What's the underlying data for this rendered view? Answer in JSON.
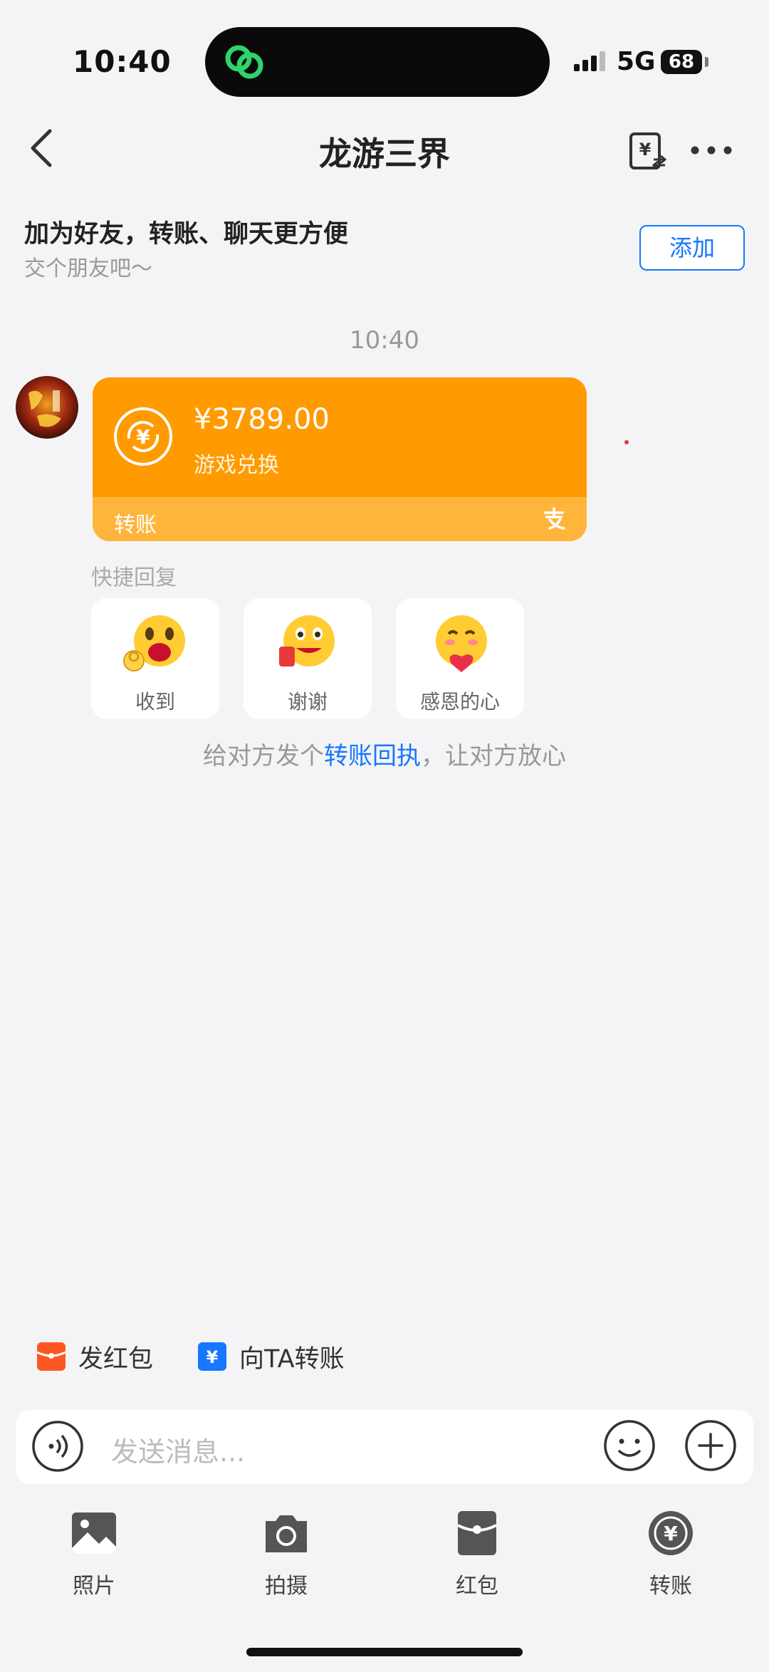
{
  "status_bar": {
    "time": "10:40",
    "network": "5G",
    "battery": "68"
  },
  "header": {
    "title": "龙游三界"
  },
  "promo": {
    "title": "加为好友，转账、聊天更方便",
    "subtitle": "交个朋友吧～",
    "add_label": "添加"
  },
  "chat": {
    "timestamp": "10:40",
    "transfer_card": {
      "amount": "¥3789.00",
      "description": "游戏兑换",
      "footer_label": "转账",
      "accent": "#ff9a00"
    },
    "quick_reply": {
      "label": "快捷回复",
      "items": [
        {
          "label": "收到",
          "icon": "ok-hand-emoji-icon"
        },
        {
          "label": "谢谢",
          "icon": "thanks-emoji-icon"
        },
        {
          "label": "感恩的心",
          "icon": "grateful-emoji-icon"
        }
      ]
    },
    "receipt_hint": {
      "before": "给对方发个",
      "link": "转账回执",
      "after": "，让对方放心"
    }
  },
  "actions": {
    "red_packet": "发红包",
    "transfer": "向TA转账"
  },
  "input": {
    "placeholder": "发送消息..."
  },
  "toolbar": {
    "items": [
      "照片",
      "拍摄",
      "红包",
      "转账"
    ]
  },
  "colors": {
    "brand_blue": "#1677ff",
    "red_packet": "#ff5722",
    "transfer_blue": "#1677ff"
  }
}
